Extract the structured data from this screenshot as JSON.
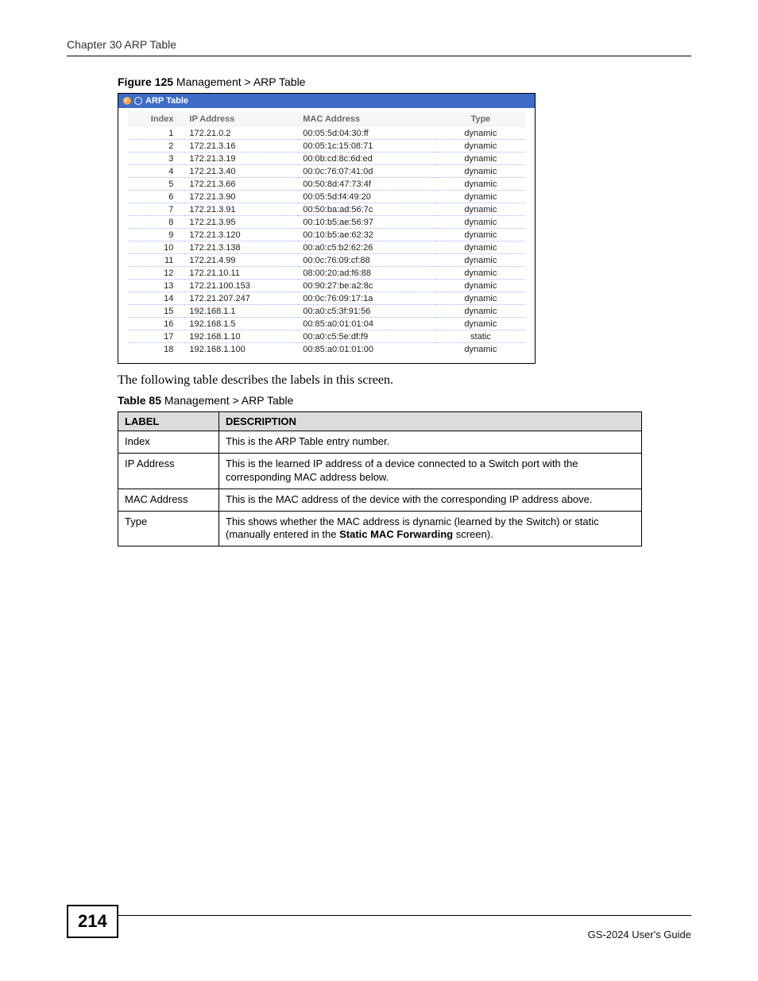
{
  "header": {
    "running_head": "Chapter 30 ARP Table"
  },
  "figure": {
    "caption_strong": "Figure 125",
    "caption_rest": "   Management > ARP Table",
    "panel_title": "ARP Table",
    "columns": {
      "index": "Index",
      "ip": "IP Address",
      "mac": "MAC Address",
      "type": "Type"
    },
    "rows": [
      {
        "idx": "1",
        "ip": "172.21.0.2",
        "mac": "00:05:5d:04:30:ff",
        "type": "dynamic"
      },
      {
        "idx": "2",
        "ip": "172.21.3.16",
        "mac": "00:05:1c:15:08:71",
        "type": "dynamic"
      },
      {
        "idx": "3",
        "ip": "172.21.3.19",
        "mac": "00:0b:cd:8c:6d:ed",
        "type": "dynamic"
      },
      {
        "idx": "4",
        "ip": "172.21.3.40",
        "mac": "00:0c:76:07:41:0d",
        "type": "dynamic"
      },
      {
        "idx": "5",
        "ip": "172.21.3.66",
        "mac": "00:50:8d:47:73:4f",
        "type": "dynamic"
      },
      {
        "idx": "6",
        "ip": "172.21.3.90",
        "mac": "00:05:5d:f4:49:20",
        "type": "dynamic"
      },
      {
        "idx": "7",
        "ip": "172.21.3.91",
        "mac": "00:50:ba:ad:56:7c",
        "type": "dynamic"
      },
      {
        "idx": "8",
        "ip": "172.21.3.95",
        "mac": "00:10:b5:ae:56:97",
        "type": "dynamic"
      },
      {
        "idx": "9",
        "ip": "172.21.3.120",
        "mac": "00:10:b5:ae:62:32",
        "type": "dynamic"
      },
      {
        "idx": "10",
        "ip": "172.21.3.138",
        "mac": "00:a0:c5:b2:62:26",
        "type": "dynamic"
      },
      {
        "idx": "11",
        "ip": "172.21.4.99",
        "mac": "00:0c:76:09:cf:88",
        "type": "dynamic"
      },
      {
        "idx": "12",
        "ip": "172.21.10.11",
        "mac": "08:00:20:ad:f6:88",
        "type": "dynamic"
      },
      {
        "idx": "13",
        "ip": "172.21.100.153",
        "mac": "00:90:27:be:a2:8c",
        "type": "dynamic"
      },
      {
        "idx": "14",
        "ip": "172.21.207.247",
        "mac": "00:0c:76:09:17:1a",
        "type": "dynamic"
      },
      {
        "idx": "15",
        "ip": "192.168.1.1",
        "mac": "00:a0:c5:3f:91:56",
        "type": "dynamic"
      },
      {
        "idx": "16",
        "ip": "192.168.1.5",
        "mac": "00:85:a0:01:01:04",
        "type": "dynamic"
      },
      {
        "idx": "17",
        "ip": "192.168.1.10",
        "mac": "00:a0:c5:5e:df:f9",
        "type": "static"
      },
      {
        "idx": "18",
        "ip": "192.168.1.100",
        "mac": "00:85:a0:01:01:00",
        "type": "dynamic"
      }
    ]
  },
  "after_figure_text": "The following table describes the labels in this screen.",
  "desc_table": {
    "caption_strong": "Table 85",
    "caption_rest": "   Management > ARP Table",
    "head_label": "LABEL",
    "head_desc": "DESCRIPTION",
    "rows": [
      {
        "label": "Index",
        "desc_pre": "This is the ARP Table entry number.",
        "bold": "",
        "desc_post": ""
      },
      {
        "label": "IP Address",
        "desc_pre": "This is the learned IP address of a device connected to a Switch port with the corresponding MAC address below.",
        "bold": "",
        "desc_post": ""
      },
      {
        "label": "MAC Address",
        "desc_pre": "This is the MAC address of the device with the corresponding IP address above.",
        "bold": "",
        "desc_post": ""
      },
      {
        "label": "Type",
        "desc_pre": "This shows whether the MAC address is dynamic (learned by the Switch) or static (manually entered in the ",
        "bold": "Static MAC Forwarding",
        "desc_post": " screen)."
      }
    ]
  },
  "footer": {
    "page_number": "214",
    "guide": "GS-2024 User's Guide"
  }
}
